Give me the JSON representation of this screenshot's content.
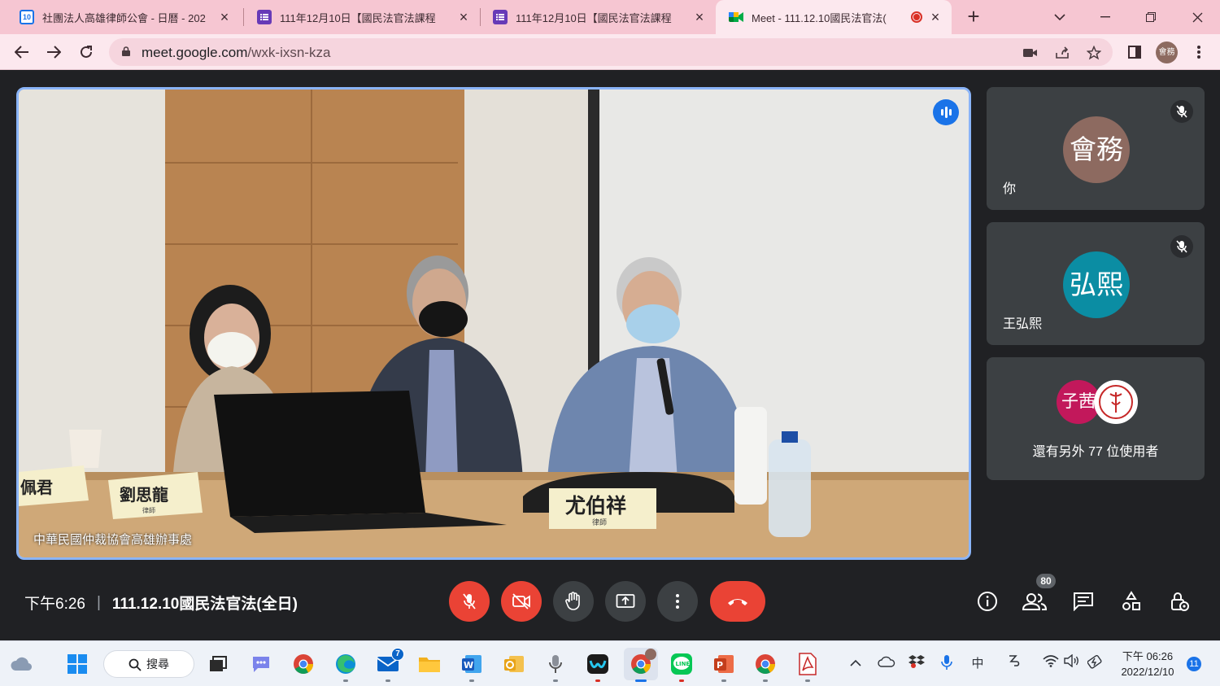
{
  "browser": {
    "tabs": [
      {
        "title": "社團法人高雄律師公會 - 日曆 - 202",
        "favicon": "google-calendar-icon",
        "favicon_text": "10"
      },
      {
        "title": "111年12月10日【國民法官法課程",
        "favicon": "google-forms-icon"
      },
      {
        "title": "111年12月10日【國民法官法課程",
        "favicon": "google-forms-icon"
      },
      {
        "title": "Meet - 111.12.10國民法官法(",
        "favicon": "google-meet-icon",
        "recording": true
      }
    ],
    "url_host": "meet.google.com",
    "url_path": "/wxk-ixsn-kza",
    "profile_label": "會務"
  },
  "meet": {
    "main_video_label": "中華民國仲裁協會高雄辦事處",
    "nameplates": [
      "佩君",
      "劉思龍",
      "尤伯祥"
    ],
    "nameplate_sub": [
      "律師",
      "律師"
    ],
    "participants": [
      {
        "avatar_text": "會務",
        "name": "你",
        "avatar_color": "#8d6a60",
        "muted": true
      },
      {
        "avatar_text": "弘熙",
        "name": "王弘熙",
        "avatar_color": "#0b8da3",
        "muted": true
      }
    ],
    "others": {
      "avatar_text": "子茜",
      "avatar_color": "#c2185b",
      "text": "還有另外 77 位使用者"
    },
    "time": "下午6:26",
    "meeting_title": "111.12.10國民法官法(全日)",
    "participant_count": "80",
    "accent": "#ea4335"
  },
  "taskbar": {
    "search_label": "搜尋",
    "mail_badge": "7",
    "ime_label": "中",
    "clock_time": "下午 06:26",
    "clock_date": "2022/12/10",
    "notification_count": "11"
  }
}
